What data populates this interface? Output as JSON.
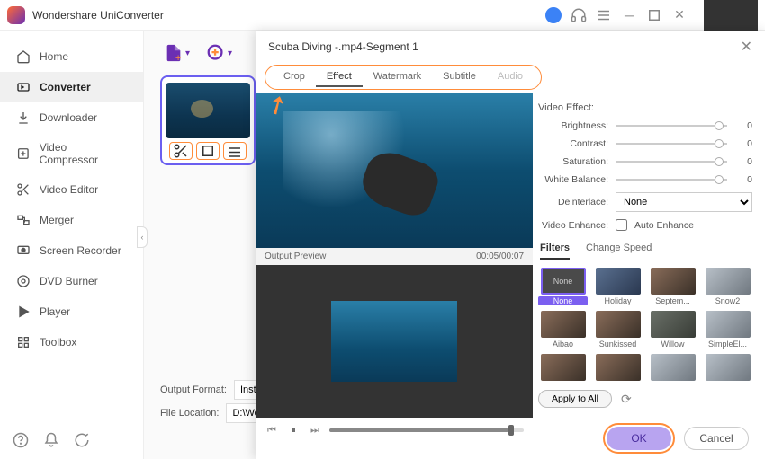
{
  "app_title": "Wondershare UniConverter",
  "sidebar": {
    "items": [
      {
        "label": "Home",
        "icon": "home"
      },
      {
        "label": "Converter",
        "icon": "convert"
      },
      {
        "label": "Downloader",
        "icon": "download"
      },
      {
        "label": "Video Compressor",
        "icon": "compress"
      },
      {
        "label": "Video Editor",
        "icon": "scissors"
      },
      {
        "label": "Merger",
        "icon": "merge"
      },
      {
        "label": "Screen Recorder",
        "icon": "record"
      },
      {
        "label": "DVD Burner",
        "icon": "disc"
      },
      {
        "label": "Player",
        "icon": "play"
      },
      {
        "label": "Toolbox",
        "icon": "grid"
      }
    ],
    "active_index": 1
  },
  "output_format_label": "Output Format:",
  "output_format_value": "Instagram F",
  "file_location_label": "File Location:",
  "file_location_value": "D:\\Wonder",
  "modal": {
    "title": "Scuba Diving -.mp4-Segment 1",
    "tabs": [
      "Crop",
      "Effect",
      "Watermark",
      "Subtitle",
      "Audio"
    ],
    "active_tab": 1,
    "disabled_tabs": [
      4
    ],
    "output_preview_label": "Output Preview",
    "time_display": "00:05/00:07",
    "effects": {
      "title": "Video Effect:",
      "sliders": [
        {
          "label": "Brightness:",
          "value": 0
        },
        {
          "label": "Contrast:",
          "value": 0
        },
        {
          "label": "Saturation:",
          "value": 0
        },
        {
          "label": "White Balance:",
          "value": 0
        }
      ],
      "deinterlace_label": "Deinterlace:",
      "deinterlace_value": "None",
      "enhance_label": "Video Enhance:",
      "enhance_checkbox": "Auto Enhance"
    },
    "subtabs": [
      "Filters",
      "Change Speed"
    ],
    "active_subtab": 0,
    "filters": [
      {
        "label": "None",
        "style": "none",
        "selected": true
      },
      {
        "label": "Holiday",
        "style": "holiday"
      },
      {
        "label": "Septem...",
        "style": "default"
      },
      {
        "label": "Snow2",
        "style": "snow"
      },
      {
        "label": "Aibao",
        "style": "default"
      },
      {
        "label": "Sunkissed",
        "style": "default"
      },
      {
        "label": "Willow",
        "style": "willow"
      },
      {
        "label": "SimpleEl...",
        "style": "snow"
      },
      {
        "label": "",
        "style": "default"
      },
      {
        "label": "",
        "style": "default"
      },
      {
        "label": "",
        "style": "snow"
      },
      {
        "label": "",
        "style": "snow"
      }
    ],
    "apply_all_label": "Apply to All",
    "ok_label": "OK",
    "cancel_label": "Cancel"
  }
}
